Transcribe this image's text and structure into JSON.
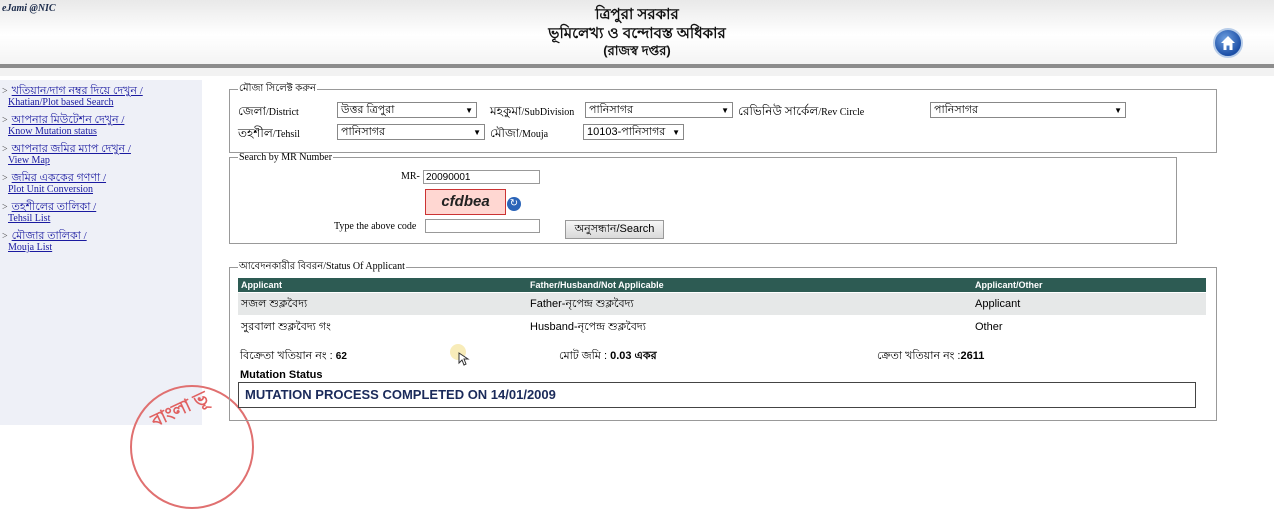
{
  "header": {
    "brand": "eJami @NIC",
    "title_line1": "ত্রিপুরা সরকার",
    "title_line2": "ভূমিলেখ্য ও বন্দোবস্ত অধিকার",
    "title_line3": "(রাজস্ব দপ্তর)"
  },
  "icons": {
    "home": "home-icon",
    "refresh": "refresh-icon"
  },
  "sidebar": {
    "items": [
      {
        "bn": "খতিয়ান/দাগ নম্বর দিয়ে দেখুন /",
        "en": "Khatian/Plot based Search"
      },
      {
        "bn": "আপনার মিউটেশন দেখুন /",
        "en": "Know Mutation status"
      },
      {
        "bn": "আপনার জমির ম্যাপ দেখুন /",
        "en": "View Map"
      },
      {
        "bn": "জমির এককের গণণা /",
        "en": "Plot Unit Conversion"
      },
      {
        "bn": "তহশীলের তালিকা /",
        "en": "Tehsil List"
      },
      {
        "bn": "মৌজার তালিকা /",
        "en": "Mouja List"
      }
    ],
    "arrow": ">"
  },
  "mouja_section": {
    "legend": "মৌজা সিলেক্ট করুন",
    "district_label_bn": "জেলা",
    "district_label_en": "/District",
    "district_value": "উত্তর ত্রিপুরা",
    "subdivision_label_bn": "মহকুমা",
    "subdivision_label_en": "/SubDivision",
    "subdivision_value": "পানিসাগর",
    "revcircle_label_bn": "রেভিনিউ সার্কেল",
    "revcircle_label_en": "/Rev Circle",
    "revcircle_value": "পানিসাগর",
    "tehsil_label_bn": "তহশীল",
    "tehsil_label_en": "/Tehsil",
    "tehsil_value": "পানিসাগর",
    "mouja_label_bn": "মৌজা",
    "mouja_label_en": "/Mouja",
    "mouja_value": "10103-পানিসাগর"
  },
  "mr_section": {
    "legend": "Search by MR Number",
    "mr_label": "MR-",
    "mr_value": "20090001",
    "captcha_text": "cfdbea",
    "code_label": "Type the above code",
    "code_value": "",
    "search_button": "অনুসন্ধান/Search"
  },
  "applicant_section": {
    "legend_bn": "আবেদনকারীর বিবরন",
    "legend_en": "/Status Of Applicant",
    "columns": [
      "Applicant",
      "Father/Husband/Not Applicable",
      "Applicant/Other"
    ],
    "rows": [
      [
        "সজল শুক্লবৈদ্য",
        "Father-নৃপেন্দ্র শুক্লবৈদ্য",
        "Applicant"
      ],
      [
        "সুরবালা শুক্লবৈদ্য গং",
        "Husband-নৃপেন্দ্র শুক্লবৈদ্য",
        "Other"
      ]
    ],
    "seller_label": "বিক্রেতা খতিয়ান নং : ",
    "seller_value": "62",
    "total_land_label": "মোট জমি : ",
    "total_land_value": "0.03 একর",
    "buyer_label": "ক্রেতা খতিয়ান নং :",
    "buyer_value": "2611",
    "mutation_title": "Mutation Status",
    "mutation_status": "MUTATION PROCESS COMPLETED ON 14/01/2009"
  },
  "colors": {
    "table_header": "#2d5b53",
    "row_alt": "#e6e8e8",
    "link": "#1a1aa0"
  }
}
